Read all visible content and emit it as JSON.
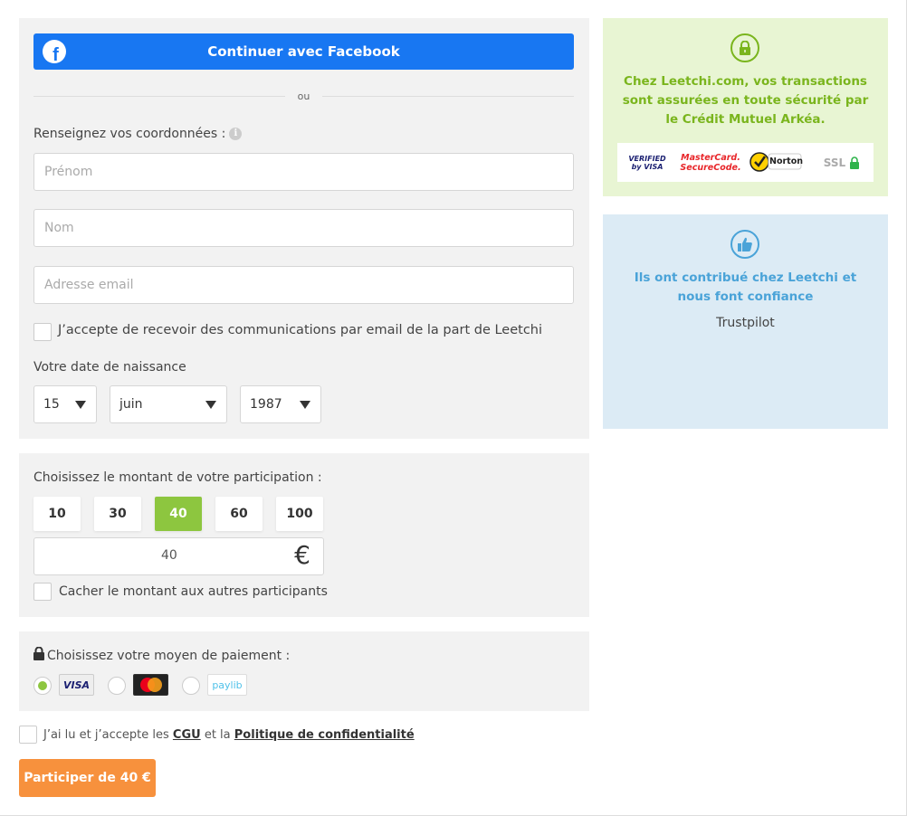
{
  "facebook": {
    "button_label": "Continuer avec Facebook",
    "icon": "facebook-icon"
  },
  "separator": {
    "label": "ou"
  },
  "identity": {
    "label": "Renseignez vos coordonnées :",
    "info_icon": "i",
    "firstname_placeholder": "Prénom",
    "lastname_placeholder": "Nom",
    "email_placeholder": "Adresse email",
    "newsletter_label": "J’accepte de recevoir des communications par email de la part de Leetchi"
  },
  "birthdate": {
    "label": "Votre date de naissance",
    "day": "15",
    "month": "juin",
    "year": "1987"
  },
  "amount": {
    "label": "Choisissez le montant de votre participation :",
    "options": [
      "10",
      "30",
      "40",
      "60",
      "100"
    ],
    "selected": "40",
    "value": "40",
    "currency": "€",
    "hide_label": "Cacher le montant aux autres participants"
  },
  "payment": {
    "label": "Choisissez votre moyen de paiement :",
    "methods": [
      {
        "name": "VISA",
        "selected": true
      },
      {
        "name": "MasterCard",
        "selected": false
      },
      {
        "name": "paylib",
        "selected": false
      }
    ]
  },
  "terms": {
    "prefix": "J’ai lu et j’accepte les",
    "cgu": "CGU",
    "middle": "et la",
    "privacy": "Politique de confidentialité"
  },
  "submit": {
    "label": "Participer de 40 €"
  },
  "security": {
    "text": "Chez Leetchi.com, vos transactions sont assurées en toute sécurité par le Crédit Mutuel Arkéa.",
    "badges": [
      "VERIFIED by VISA",
      "MasterCard. SecureCode.",
      "Norton",
      "SSL"
    ],
    "color": "#7ab51d"
  },
  "trust": {
    "text": "Ils ont contribué chez Leetchi et nous font confiance",
    "source": "Trustpilot",
    "color": "#4aa3d8"
  },
  "colors": {
    "facebook": "#1877f2",
    "accent_green": "#8dc63f",
    "submit_orange": "#f7913d"
  }
}
